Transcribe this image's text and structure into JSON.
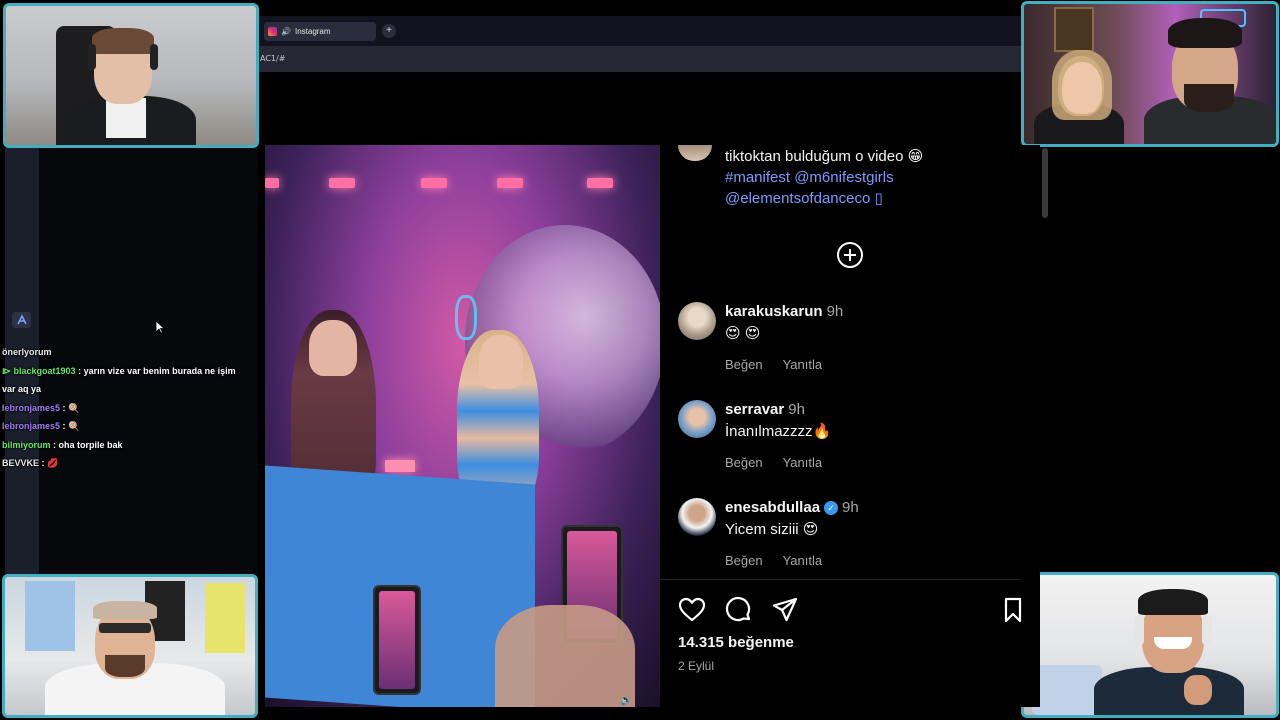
{
  "browser": {
    "tab_label": "Instagram",
    "new_tab_label": "+",
    "url_fragment": "AC1/#"
  },
  "chat": [
    {
      "user": "önerlyorum",
      "message": "",
      "color": "white",
      "partial": true
    },
    {
      "user": "blackgoat1903",
      "message": "yarın vize var benim burada ne işim",
      "color": "green"
    },
    {
      "user": "",
      "message": "var aq ya",
      "color": "white"
    },
    {
      "user": "lebronjames5",
      "message": "🍭",
      "color": "purple"
    },
    {
      "user": "lebronjames5",
      "message": "🍭",
      "color": "purple"
    },
    {
      "user": "bilmiyorum",
      "message": "oha torpile bak",
      "color": "green"
    },
    {
      "user": "BEVVKE",
      "message": "💋",
      "color": "white"
    }
  ],
  "post": {
    "caption": {
      "text": "tiktoktan bulduğum o video 😁",
      "tags_line1": "#manifest @m6nifestgirls",
      "tags_line2": "@elementsofdanceco ▯"
    },
    "comments": [
      {
        "username": "karakuskarun",
        "time": "9h",
        "text": "😍 😍",
        "verified": false
      },
      {
        "username": "serravar",
        "time": "9h",
        "text": "İnanılmazzzz🔥",
        "verified": false
      },
      {
        "username": "enesabdullaa",
        "time": "9h",
        "text": "Yicem siziii 😍",
        "verified": true
      }
    ],
    "like_label": "Beğen",
    "reply_label": "Yanıtla",
    "likes_text": "14.315 beğenme",
    "date_text": "2 Eylül",
    "icons": [
      "heart-icon",
      "comment-icon",
      "share-icon",
      "bookmark-icon",
      "add-comment-icon",
      "mute-icon"
    ]
  },
  "colors": {
    "cam_border": "#43aec0",
    "link": "#7f9bff",
    "muted_text": "#a8a8a8",
    "verified": "#3897f0"
  }
}
